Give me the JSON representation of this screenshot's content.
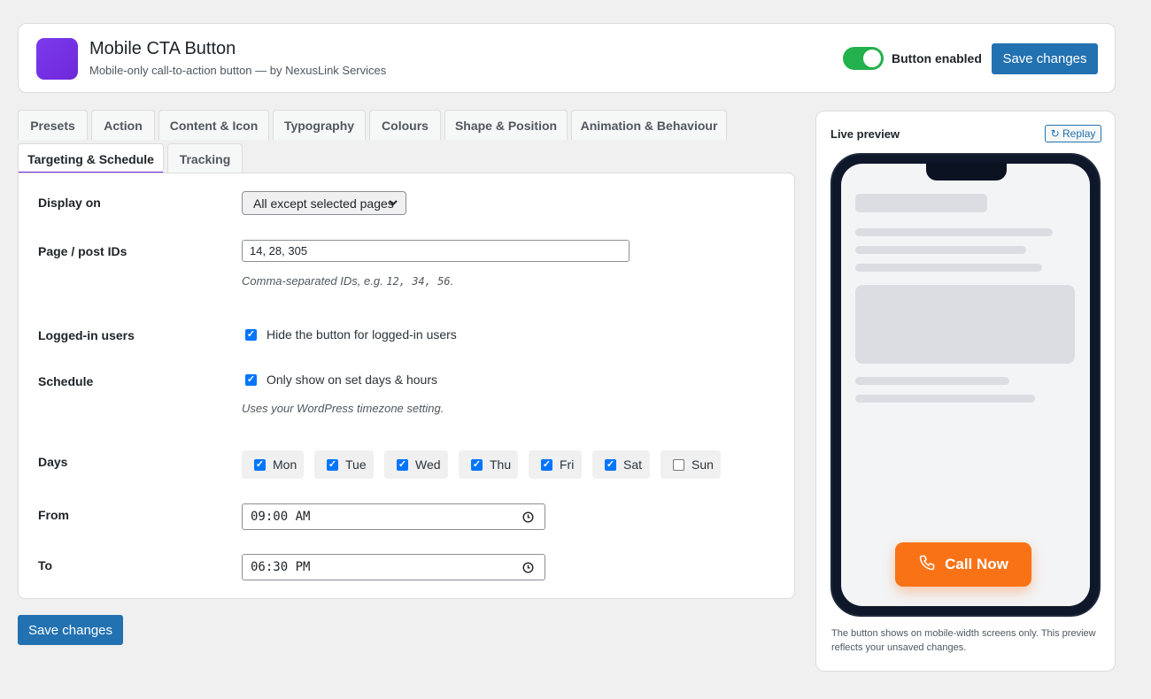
{
  "app": {
    "title": "Mobile CTA Button",
    "subtitle": "Mobile-only call-to-action button — by NexusLink Services",
    "toggle_label": "Button enabled",
    "toggle_on": true,
    "save_label": "Save changes"
  },
  "tabs": {
    "presets": "Presets",
    "action": "Action",
    "content_icon": "Content & Icon",
    "typography": "Typography",
    "colours": "Colours",
    "shape_position": "Shape & Position",
    "animation": "Animation & Behaviour",
    "targeting": "Targeting & Schedule",
    "tracking": "Tracking",
    "active": "Targeting & Schedule"
  },
  "form": {
    "display_on": {
      "label": "Display on",
      "value": "All except selected pages"
    },
    "page_ids": {
      "label": "Page / post IDs",
      "value": "14, 28, 305",
      "hint_prefix": "Comma-separated IDs, e.g.",
      "hint_code": "12, 34, 56",
      "hint_suffix": "."
    },
    "logged_in": {
      "label": "Logged-in users",
      "checkbox_label": "Hide the button for logged-in users",
      "checked": true
    },
    "schedule": {
      "label": "Schedule",
      "checkbox_label": "Only show on set days & hours",
      "checked": true,
      "hint": "Uses your WordPress timezone setting."
    },
    "days": {
      "label": "Days",
      "items": [
        {
          "label": "Mon",
          "checked": true
        },
        {
          "label": "Tue",
          "checked": true
        },
        {
          "label": "Wed",
          "checked": true
        },
        {
          "label": "Thu",
          "checked": true
        },
        {
          "label": "Fri",
          "checked": true
        },
        {
          "label": "Sat",
          "checked": true
        },
        {
          "label": "Sun",
          "checked": false
        }
      ]
    },
    "from": {
      "label": "From",
      "value": "09:00 AM"
    },
    "to": {
      "label": "To",
      "value": "06:30 PM"
    }
  },
  "footer": {
    "save_label": "Save changes"
  },
  "preview": {
    "title": "Live preview",
    "replay_label": "↻ Replay",
    "cta_label": "Call Now",
    "cta_color": "#f97316",
    "note": "The button shows on mobile-width screens only. This preview reflects your unsaved changes."
  }
}
